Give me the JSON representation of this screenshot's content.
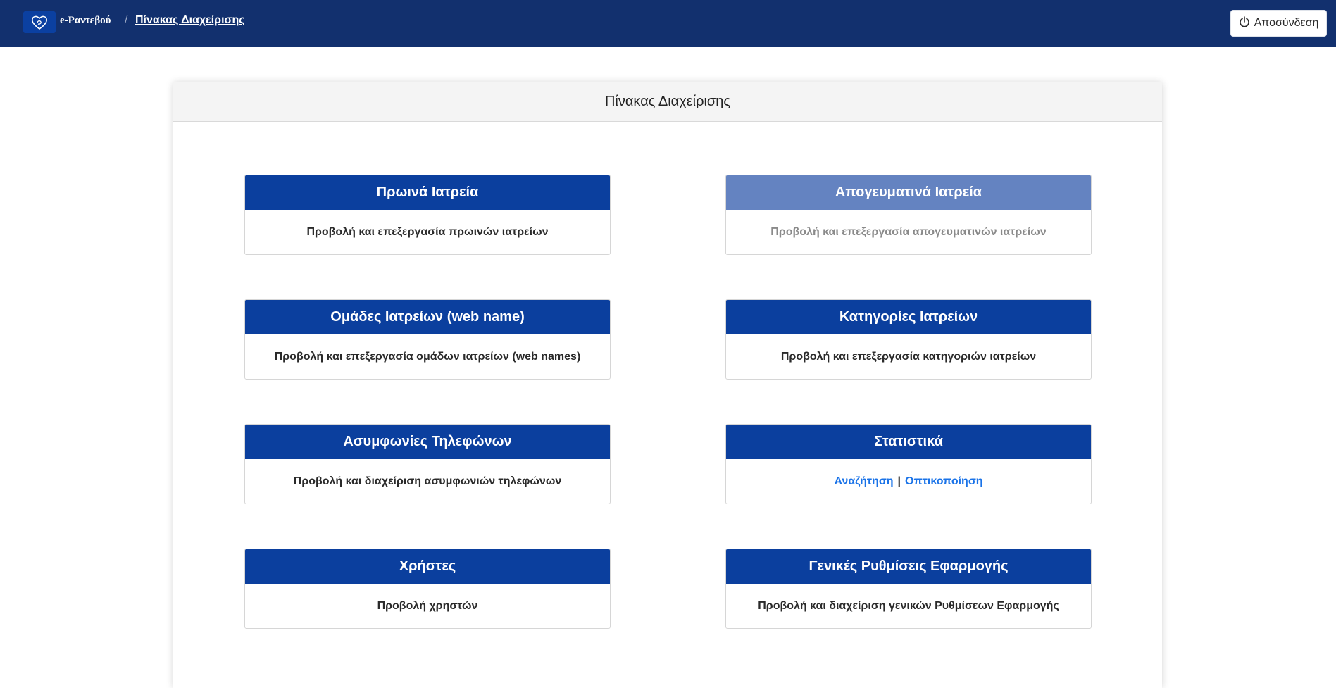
{
  "topbar": {
    "brand": "e-Ραντεβού",
    "breadcrumb_separator": "/",
    "breadcrumb_current": "Πίνακας Διαχείρισης",
    "logout_label": "Αποσύνδεση",
    "logo_icon": "heart-logo-icon",
    "logout_icon": "power-icon",
    "bar_color": "#12306e"
  },
  "panel": {
    "title": "Πίνακας Διαχείρισης"
  },
  "tiles": {
    "morning": {
      "title": "Πρωινά Ιατρεία",
      "description": "Προβολή και επεξεργασία πρωινών ιατρείων"
    },
    "afternoon": {
      "title": "Απογευματινά Ιατρεία",
      "description": "Προβολή και επεξεργασία απογευματινών ιατρείων",
      "state": "disabled"
    },
    "groups": {
      "title": "Ομάδες Ιατρείων (web name)",
      "description": "Προβολή και επεξεργασία ομάδων ιατρείων (web names)"
    },
    "categories": {
      "title": "Κατηγορίες Ιατρείων",
      "description": "Προβολή και επεξεργασία κατηγοριών ιατρείων"
    },
    "phones": {
      "title": "Ασυμφωνίες Τηλεφώνων",
      "description": "Προβολή και διαχείριση ασυμφωνιών τηλεφώνων"
    },
    "stats": {
      "title": "Στατιστικά",
      "link_search": "Αναζήτηση",
      "link_separator": "|",
      "link_visualization": "Οπτικοποίηση"
    },
    "users": {
      "title": "Χρήστες",
      "description": "Προβολή χρηστών"
    },
    "settings": {
      "title": "Γενικές Ρυθμίσεις Εφαρμογής",
      "description": "Προβολή και διαχείριση γενικών Ρυθμίσεων Εφαρμογής"
    }
  },
  "colors": {
    "tile_header": "#0b3f9e",
    "tile_header_disabled": "#6483c1",
    "link": "#1a73e8"
  }
}
